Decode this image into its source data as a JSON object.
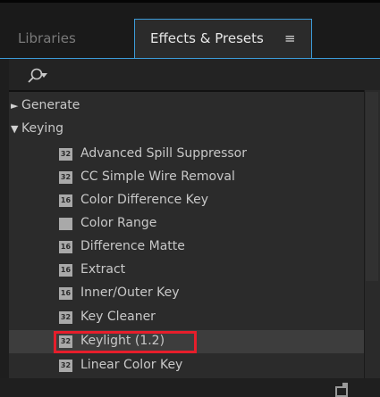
{
  "tabs": {
    "libraries": "Libraries",
    "effects_presets": "Effects & Presets",
    "menu_glyph": "≡"
  },
  "search": {
    "icon": "search-icon"
  },
  "tree": {
    "categories": [
      {
        "label": "Generate",
        "arrow": "►",
        "expanded": false
      },
      {
        "label": "Keying",
        "arrow": "▼",
        "expanded": true
      }
    ],
    "effects": [
      {
        "badge": "32",
        "label": "Advanced Spill Suppressor"
      },
      {
        "badge": "32",
        "label": "CC Simple Wire Removal"
      },
      {
        "badge": "16",
        "label": "Color Difference Key"
      },
      {
        "badge": "",
        "label": "Color Range"
      },
      {
        "badge": "16",
        "label": "Difference Matte"
      },
      {
        "badge": "16",
        "label": "Extract"
      },
      {
        "badge": "16",
        "label": "Inner/Outer Key"
      },
      {
        "badge": "32",
        "label": "Key Cleaner"
      },
      {
        "badge": "32",
        "label": "Keylight (1.2)",
        "selected": true
      },
      {
        "badge": "32",
        "label": "Linear Color Key"
      }
    ]
  },
  "colors": {
    "accent_blue": "#3c9bd8",
    "highlight_red": "#e61e2b"
  }
}
